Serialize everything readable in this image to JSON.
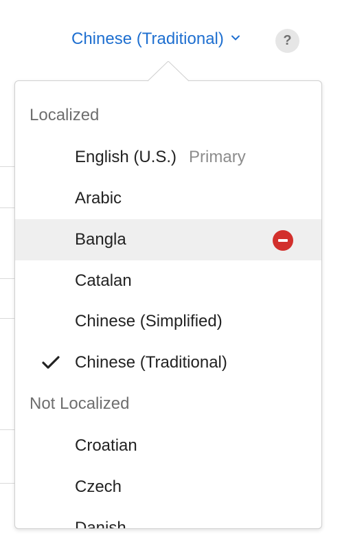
{
  "language_selector": {
    "current": "Chinese (Traditional)",
    "chevron_icon": "chevron-down-icon",
    "help_label": "?"
  },
  "popover": {
    "localized_header": "Localized",
    "not_localized_header": "Not Localized",
    "localized_items": [
      {
        "label": "English (U.S.)",
        "secondary": "Primary"
      },
      {
        "label": "Arabic"
      },
      {
        "label": "Bangla",
        "hovered": true,
        "action_icon": "remove-icon"
      },
      {
        "label": "Catalan"
      },
      {
        "label": "Chinese (Simplified)"
      },
      {
        "label": "Chinese (Traditional)",
        "selected": true,
        "selected_icon": "checkmark-icon"
      }
    ],
    "not_localized_items": [
      {
        "label": "Croatian"
      },
      {
        "label": "Czech"
      },
      {
        "label": "Danish"
      }
    ]
  },
  "colors": {
    "link_blue": "#1e6fd0",
    "remove_red": "#d2302c",
    "hover_gray": "#efefef"
  }
}
